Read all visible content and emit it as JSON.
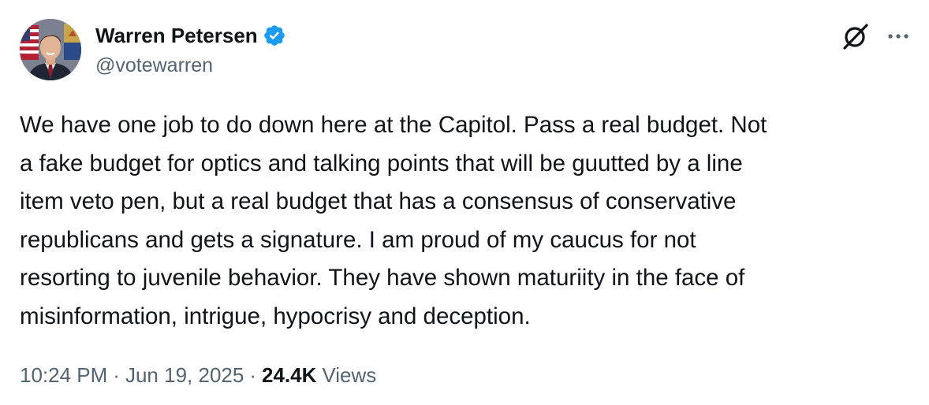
{
  "author": {
    "display_name": "Warren Petersen",
    "handle": "@votewarren",
    "verified": true,
    "verified_color": "#1d9bf0"
  },
  "icons": {
    "avatar": "profile-photo",
    "verified": "verified-badge-icon",
    "grok": "grok-icon",
    "more": "more-options-icon"
  },
  "tweet": {
    "lines": [
      "We have one job to do down here at the Capitol. Pass a real budget.  Not",
      "a fake budget for optics and talking points that will be guutted by a line",
      "item veto pen, but a real budget that has a consensus of conservative",
      "republicans and gets a signature.  I am proud of my caucus for not",
      "resorting to juvenile behavior. They have shown maturiity in the face of",
      "misinformation, intrigue, hypocrisy and deception."
    ]
  },
  "meta": {
    "time": "10:24 PM",
    "separator": "·",
    "date": "Jun 19, 2025",
    "views_count": "24.4K",
    "views_label": "Views"
  },
  "colors": {
    "text_primary": "#0f1419",
    "text_secondary": "#536471",
    "accent": "#1d9bf0"
  }
}
